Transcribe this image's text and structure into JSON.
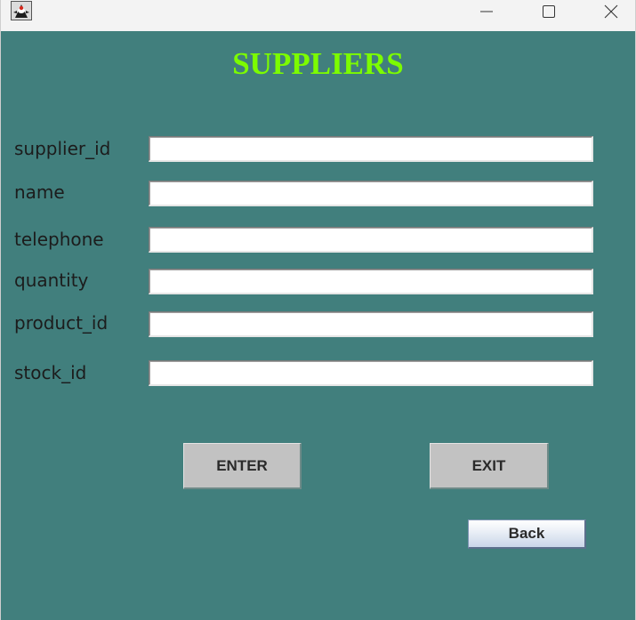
{
  "window": {
    "icon": "java-duke-icon"
  },
  "form": {
    "title": "SUPPLIERS",
    "fields": [
      {
        "label": "supplier_id",
        "value": ""
      },
      {
        "label": "name",
        "value": ""
      },
      {
        "label": "telephone",
        "value": ""
      },
      {
        "label": "quantity",
        "value": ""
      },
      {
        "label": "product_id",
        "value": ""
      },
      {
        "label": "stock_id",
        "value": ""
      }
    ],
    "buttons": {
      "enter_label": "ENTER",
      "exit_label": "EXIT",
      "back_label": "Back"
    }
  },
  "colors": {
    "background": "#417f7d",
    "title": "#7cfc00",
    "button": "#c2c2c2"
  }
}
